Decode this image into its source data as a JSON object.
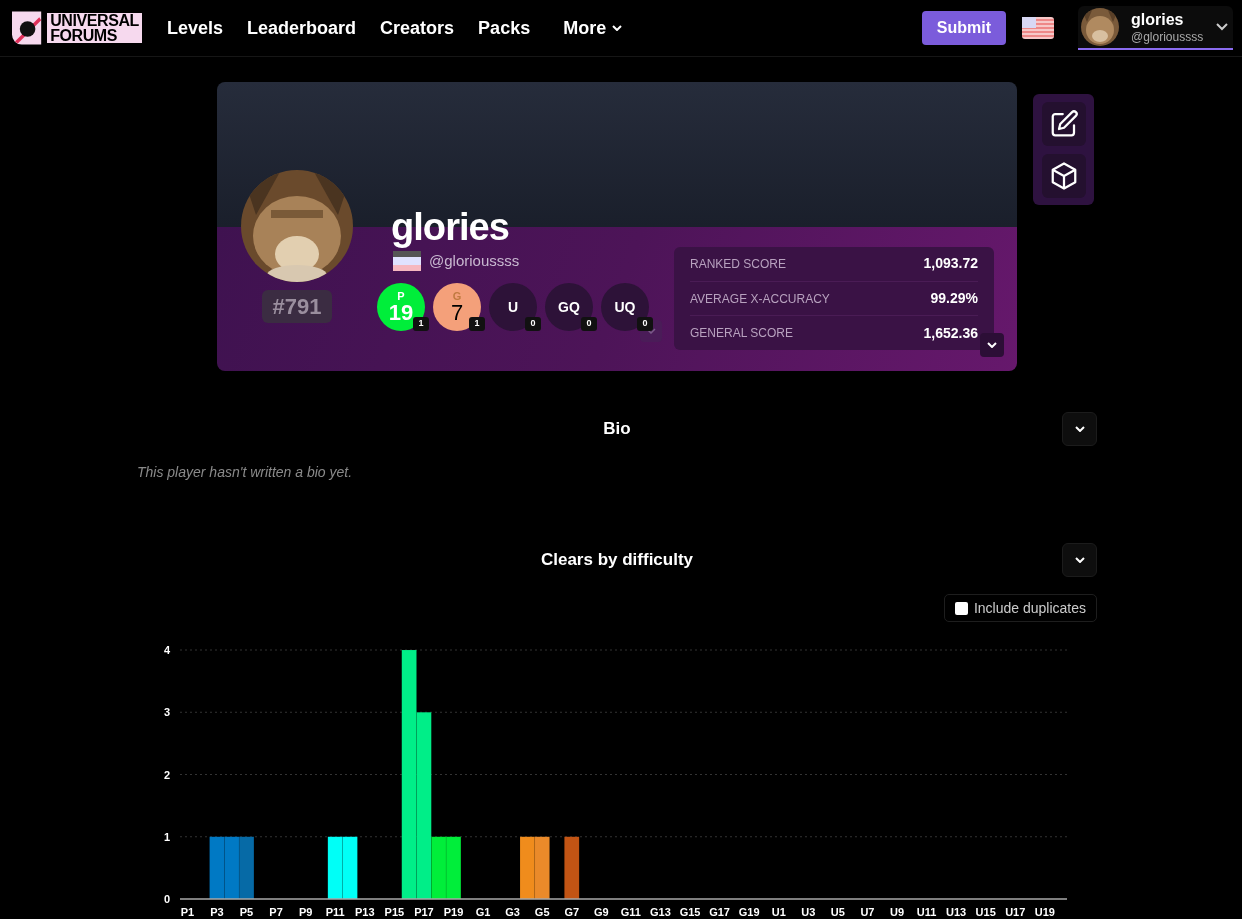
{
  "brand": {
    "line_1": "UNIVERSAL",
    "line_2": "FORUMS"
  },
  "nav": [
    {
      "label": "Levels",
      "dropdown": false
    },
    {
      "label": "Leaderboard",
      "dropdown": false
    },
    {
      "label": "Creators",
      "dropdown": false
    },
    {
      "label": "Packs",
      "dropdown": false
    },
    {
      "label": "More",
      "dropdown": true
    }
  ],
  "header_actions": {
    "submit": "Submit",
    "user": {
      "name": "glories",
      "handle": "@glorioussss"
    }
  },
  "profile": {
    "name": "glories",
    "handle": "@glorioussss",
    "rank": "#791",
    "badges": [
      {
        "kind": "filled",
        "letter": "P",
        "count": "19",
        "clears": "1",
        "color": "#00ee3a"
      },
      {
        "kind": "filled",
        "letter": "G",
        "count": "7",
        "clears": "1",
        "color": "#f4a07a"
      },
      {
        "kind": "empty",
        "letter": "U",
        "clears": "0"
      },
      {
        "kind": "empty",
        "letter": "GQ",
        "clears": "0"
      },
      {
        "kind": "empty",
        "letter": "UQ",
        "clears": "0"
      }
    ],
    "stats": [
      {
        "label": "RANKED SCORE",
        "value": "1,093.72"
      },
      {
        "label": "AVERAGE X-ACCURACY",
        "value": "99.29%"
      },
      {
        "label": "GENERAL SCORE",
        "value": "1,652.36"
      }
    ]
  },
  "bio": {
    "title": "Bio",
    "text": "This player hasn't written a bio yet."
  },
  "clears": {
    "title": "Clears by difficulty",
    "include_duplicates": {
      "label": "Include duplicates",
      "checked": false
    },
    "chart_data": {
      "type": "bar",
      "grid": true,
      "ylim": [
        0,
        4
      ],
      "yticks": [
        0,
        1,
        2,
        3,
        4
      ],
      "categories": [
        "P1",
        null,
        "P3",
        null,
        "P5",
        null,
        "P7",
        null,
        "P9",
        null,
        "P11",
        null,
        "P13",
        null,
        "P15",
        null,
        "P17",
        null,
        "P19",
        null,
        "G1",
        null,
        "G3",
        null,
        "G5",
        null,
        "G7",
        null,
        "G9",
        null,
        "G11",
        null,
        "G13",
        null,
        "G15",
        null,
        "G17",
        null,
        "G19",
        null,
        "U1",
        null,
        "U3",
        null,
        "U5",
        null,
        "U7",
        null,
        "U9",
        null,
        "U11",
        null,
        "U13",
        null,
        "U15",
        null,
        "U17",
        null,
        "U19",
        null
      ],
      "values": [
        0,
        0,
        1,
        1,
        1,
        0,
        0,
        0,
        0,
        0,
        1,
        1,
        0,
        0,
        0,
        4,
        3,
        1,
        1,
        0,
        0,
        0,
        0,
        1,
        1,
        0,
        1,
        0,
        0,
        0,
        0,
        0,
        0,
        0,
        0,
        0,
        0,
        0,
        0,
        0,
        0,
        0,
        0,
        0,
        0,
        0,
        0,
        0,
        0,
        0,
        0,
        0,
        0,
        0,
        0,
        0,
        0,
        0,
        0,
        0
      ],
      "colors": [
        null,
        null,
        "#0079c4",
        "#0079c4",
        "#066aa6",
        null,
        null,
        null,
        null,
        null,
        "#00fff7",
        "#00fff7",
        null,
        null,
        null,
        "#00ee88",
        "#00ee88",
        "#00ee3a",
        "#00ee3a",
        null,
        null,
        null,
        null,
        "#f08c1c",
        "#ea8a2a",
        null,
        "#c25414",
        null,
        null,
        null,
        null,
        null,
        null,
        null,
        null,
        null,
        null,
        null,
        null,
        null,
        null,
        null,
        null,
        null,
        null,
        null,
        null,
        null,
        null,
        null,
        null,
        null,
        null,
        null,
        null,
        null,
        null,
        null,
        null,
        null
      ]
    }
  }
}
